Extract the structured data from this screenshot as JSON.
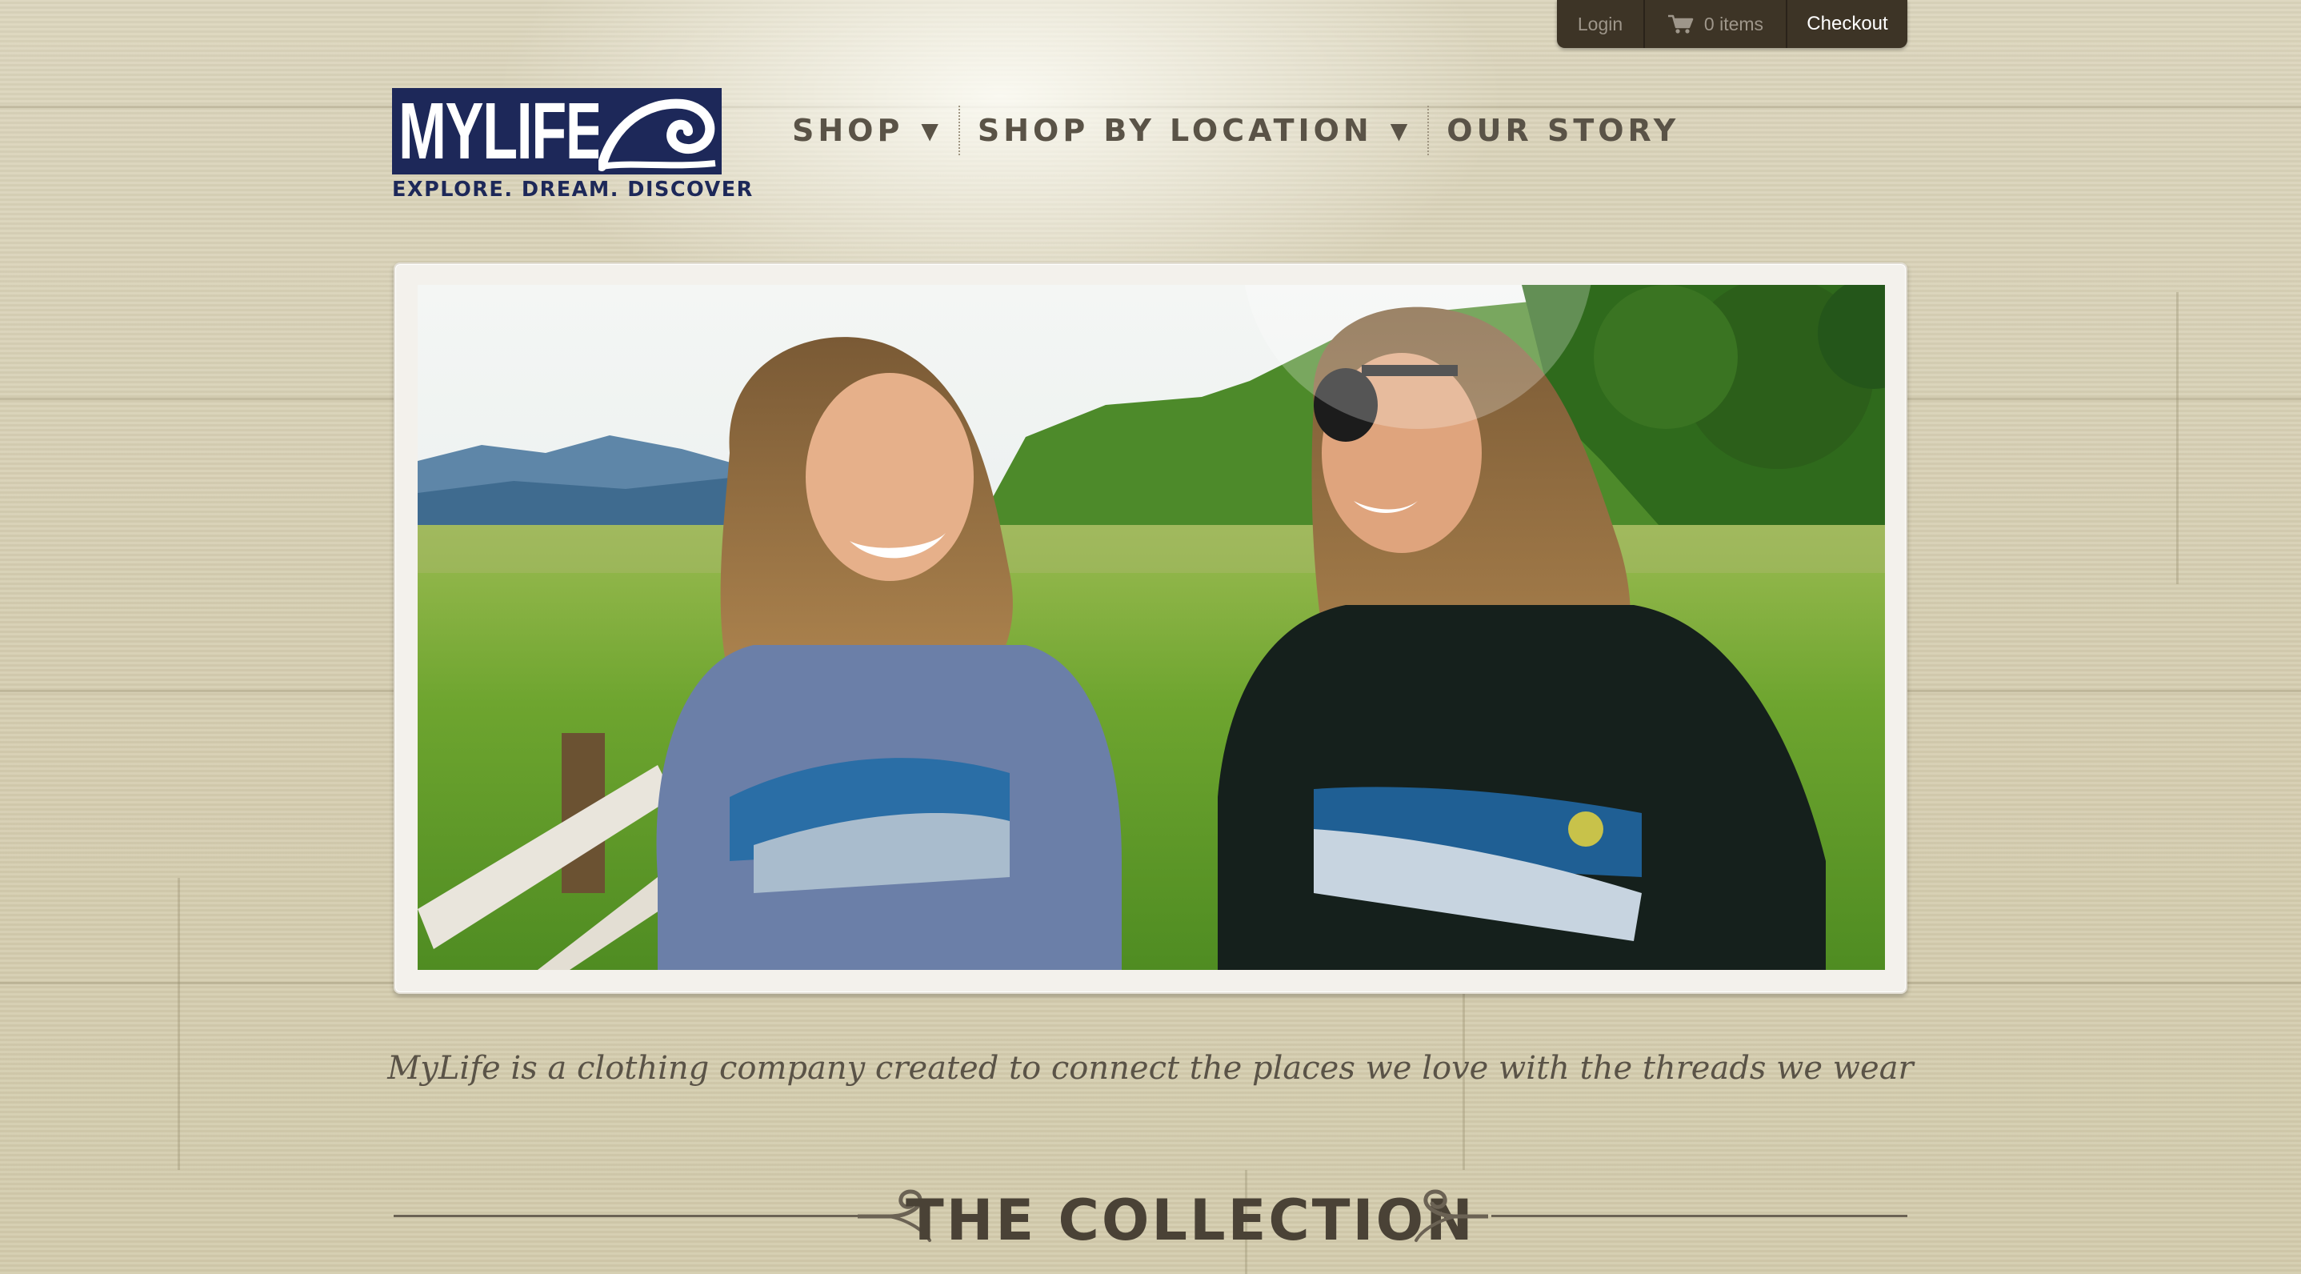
{
  "utility_bar": {
    "login_label": "Login",
    "cart_label": "0 items",
    "checkout_label": "Checkout"
  },
  "logo": {
    "wordmark": "MYLIFE",
    "tagline": "EXPLORE. DREAM. DISCOVER"
  },
  "nav": {
    "items": [
      {
        "label": "SHOP",
        "has_dropdown": true
      },
      {
        "label": "SHOP BY LOCATION",
        "has_dropdown": true
      },
      {
        "label": "OUR STORY",
        "has_dropdown": false
      }
    ],
    "dropdown_glyph": "▼"
  },
  "intro": {
    "text": "MyLife is a clothing company created to connect the places we love with the threads we wear"
  },
  "collection": {
    "heading": "THE COLLECTION"
  },
  "colors": {
    "brand_navy": "#1d2859",
    "util_bar": "#3d3426",
    "text_brown": "#5a5347",
    "background": "#d6cfb3"
  },
  "icons": [
    "cart-icon",
    "logo-wave-icon",
    "dropdown-arrow-icon",
    "swirl-ornament-icon"
  ]
}
